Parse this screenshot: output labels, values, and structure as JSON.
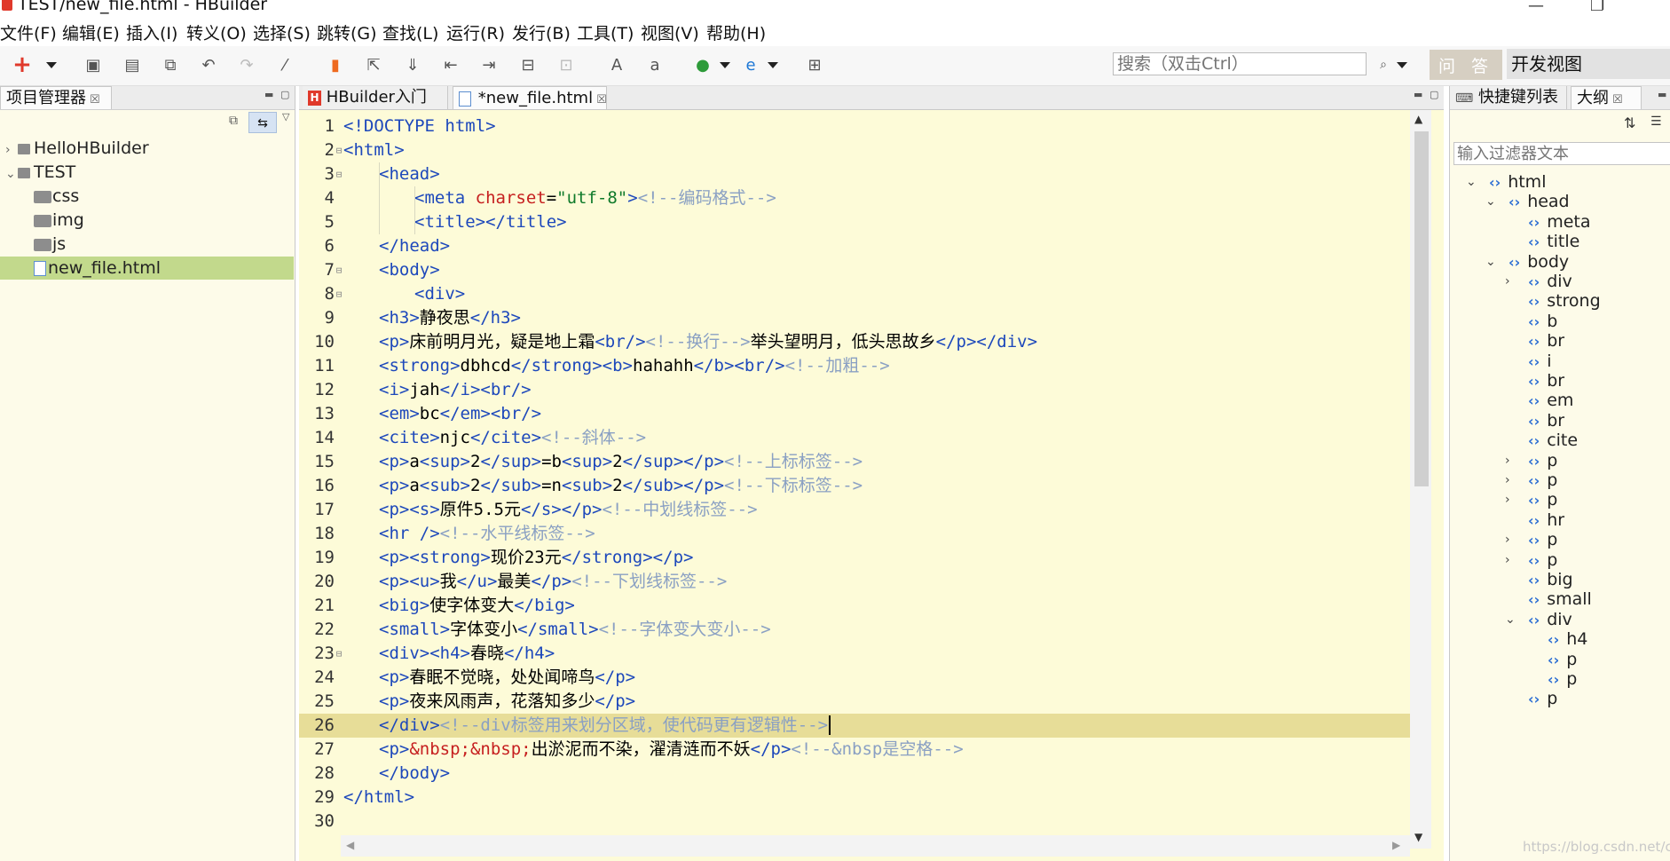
{
  "window": {
    "title": "TEST/new_file.html  -  HBuilder",
    "min_glyph": "—",
    "max_glyph": "❐"
  },
  "menu": [
    "文件(F)",
    "编辑(E)",
    "插入(I)",
    "转义(O)",
    "选择(S)",
    "跳转(G)",
    "查找(L)",
    "运行(R)",
    "发行(B)",
    "工具(T)",
    "视图(V)",
    "帮助(H)"
  ],
  "toolbar": {
    "search_placeholder": "搜索（双击Ctrl）",
    "ask_label": "问 答",
    "dev_view_label": "开发视图"
  },
  "project_panel": {
    "tab_label": "项目管理器",
    "items": [
      {
        "name": "HelloHBuilder",
        "type": "project",
        "level": 0,
        "expanded": false
      },
      {
        "name": "TEST",
        "type": "project",
        "level": 0,
        "expanded": true
      },
      {
        "name": "css",
        "type": "folder",
        "level": 1
      },
      {
        "name": "img",
        "type": "folder",
        "level": 1
      },
      {
        "name": "js",
        "type": "folder",
        "level": 1
      },
      {
        "name": "new_file.html",
        "type": "file",
        "level": 1,
        "selected": true
      }
    ]
  },
  "editor": {
    "tabs": [
      {
        "label": "HBuilder入门",
        "active": false
      },
      {
        "label": "*new_file.html",
        "active": true
      }
    ],
    "current_line": 26,
    "lines": [
      {
        "n": 1,
        "fold": false,
        "indent": 0,
        "tokens": [
          [
            "tg",
            "<!DOCTYPE html>"
          ]
        ]
      },
      {
        "n": 2,
        "fold": true,
        "indent": 0,
        "tokens": [
          [
            "tg",
            "<html>"
          ]
        ]
      },
      {
        "n": 3,
        "fold": true,
        "indent": 1,
        "tokens": [
          [
            "tg",
            "<head>"
          ]
        ]
      },
      {
        "n": 4,
        "fold": false,
        "indent": 2,
        "tokens": [
          [
            "tg",
            "<meta "
          ],
          [
            "at",
            "charset"
          ],
          [
            "tx",
            "="
          ],
          [
            "st",
            "\"utf-8\""
          ],
          [
            "tg",
            ">"
          ],
          [
            "cm",
            "<!--编码格式-->"
          ]
        ]
      },
      {
        "n": 5,
        "fold": false,
        "indent": 2,
        "tokens": [
          [
            "tg",
            "<title></title>"
          ]
        ]
      },
      {
        "n": 6,
        "fold": false,
        "indent": 1,
        "tokens": [
          [
            "tg",
            "</head>"
          ]
        ]
      },
      {
        "n": 7,
        "fold": true,
        "indent": 1,
        "tokens": [
          [
            "tg",
            "<body>"
          ]
        ]
      },
      {
        "n": 8,
        "fold": true,
        "indent": 2,
        "tokens": [
          [
            "tg",
            "<div>"
          ]
        ]
      },
      {
        "n": 9,
        "fold": false,
        "indent": 1,
        "tokens": [
          [
            "tg",
            "<h3>"
          ],
          [
            "tx",
            "静夜思"
          ],
          [
            "tg",
            "</h3>"
          ]
        ]
      },
      {
        "n": 10,
        "fold": false,
        "indent": 1,
        "tokens": [
          [
            "tg",
            "<p>"
          ],
          [
            "tx",
            "床前明月光，疑是地上霜"
          ],
          [
            "tg",
            "<br/>"
          ],
          [
            "cm",
            "<!--换行-->"
          ],
          [
            "tx",
            "举头望明月，低头思故乡"
          ],
          [
            "tg",
            "</p></div>"
          ]
        ]
      },
      {
        "n": 11,
        "fold": false,
        "indent": 1,
        "tokens": [
          [
            "tg",
            "<strong>"
          ],
          [
            "tx",
            "dbhcd"
          ],
          [
            "tg",
            "</strong><b>"
          ],
          [
            "tx",
            "hahahh"
          ],
          [
            "tg",
            "</b><br/>"
          ],
          [
            "cm",
            "<!--加粗-->"
          ]
        ]
      },
      {
        "n": 12,
        "fold": false,
        "indent": 1,
        "tokens": [
          [
            "tg",
            "<i>"
          ],
          [
            "tx",
            "jah"
          ],
          [
            "tg",
            "</i><br/>"
          ]
        ]
      },
      {
        "n": 13,
        "fold": false,
        "indent": 1,
        "tokens": [
          [
            "tg",
            "<em>"
          ],
          [
            "tx",
            "bc"
          ],
          [
            "tg",
            "</em><br/>"
          ]
        ]
      },
      {
        "n": 14,
        "fold": false,
        "indent": 1,
        "tokens": [
          [
            "tg",
            "<cite>"
          ],
          [
            "tx",
            "njc"
          ],
          [
            "tg",
            "</cite>"
          ],
          [
            "cm",
            "<!--斜体-->"
          ]
        ]
      },
      {
        "n": 15,
        "fold": false,
        "indent": 1,
        "tokens": [
          [
            "tg",
            "<p>"
          ],
          [
            "tx",
            "a"
          ],
          [
            "tg",
            "<sup>"
          ],
          [
            "tx",
            "2"
          ],
          [
            "tg",
            "</sup>"
          ],
          [
            "tx",
            "=b"
          ],
          [
            "tg",
            "<sup>"
          ],
          [
            "tx",
            "2"
          ],
          [
            "tg",
            "</sup></p>"
          ],
          [
            "cm",
            "<!--上标标签-->"
          ]
        ]
      },
      {
        "n": 16,
        "fold": false,
        "indent": 1,
        "tokens": [
          [
            "tg",
            "<p>"
          ],
          [
            "tx",
            "a"
          ],
          [
            "tg",
            "<sub>"
          ],
          [
            "tx",
            "2"
          ],
          [
            "tg",
            "</sub>"
          ],
          [
            "tx",
            "=n"
          ],
          [
            "tg",
            "<sub>"
          ],
          [
            "tx",
            "2"
          ],
          [
            "tg",
            "</sub></p>"
          ],
          [
            "cm",
            "<!--下标标签-->"
          ]
        ]
      },
      {
        "n": 17,
        "fold": false,
        "indent": 1,
        "tokens": [
          [
            "tg",
            "<p><s>"
          ],
          [
            "tx",
            "原件5.5元"
          ],
          [
            "tg",
            "</s></p>"
          ],
          [
            "cm",
            "<!--中划线标签-->"
          ]
        ]
      },
      {
        "n": 18,
        "fold": false,
        "indent": 1,
        "tokens": [
          [
            "tg",
            "<hr />"
          ],
          [
            "cm",
            "<!--水平线标签-->"
          ]
        ]
      },
      {
        "n": 19,
        "fold": false,
        "indent": 1,
        "tokens": [
          [
            "tg",
            "<p><strong>"
          ],
          [
            "tx",
            "现价23元"
          ],
          [
            "tg",
            "</strong></p>"
          ]
        ]
      },
      {
        "n": 20,
        "fold": false,
        "indent": 1,
        "tokens": [
          [
            "tg",
            "<p><u>"
          ],
          [
            "tx",
            "我"
          ],
          [
            "tg",
            "</u>"
          ],
          [
            "tx",
            "最美"
          ],
          [
            "tg",
            "</p>"
          ],
          [
            "cm",
            "<!--下划线标签-->"
          ]
        ]
      },
      {
        "n": 21,
        "fold": false,
        "indent": 1,
        "tokens": [
          [
            "tg",
            "<big>"
          ],
          [
            "tx",
            "使字体变大"
          ],
          [
            "tg",
            "</big>"
          ]
        ]
      },
      {
        "n": 22,
        "fold": false,
        "indent": 1,
        "tokens": [
          [
            "tg",
            "<small>"
          ],
          [
            "tx",
            "字体变小"
          ],
          [
            "tg",
            "</small>"
          ],
          [
            "cm",
            "<!--字体变大变小-->"
          ]
        ]
      },
      {
        "n": 23,
        "fold": true,
        "indent": 1,
        "tokens": [
          [
            "tg",
            "<div><h4>"
          ],
          [
            "tx",
            "春晓"
          ],
          [
            "tg",
            "</h4>"
          ]
        ]
      },
      {
        "n": 24,
        "fold": false,
        "indent": 1,
        "tokens": [
          [
            "tg",
            "<p>"
          ],
          [
            "tx",
            "春眠不觉晓，处处闻啼鸟"
          ],
          [
            "tg",
            "</p>"
          ]
        ]
      },
      {
        "n": 25,
        "fold": false,
        "indent": 1,
        "tokens": [
          [
            "tg",
            "<p>"
          ],
          [
            "tx",
            "夜来风雨声，花落知多少"
          ],
          [
            "tg",
            "</p>"
          ]
        ]
      },
      {
        "n": 26,
        "fold": false,
        "indent": 1,
        "tokens": [
          [
            "tg",
            "</div>"
          ],
          [
            "cm",
            "<!--div标签用来划分区域，使代码更有逻辑性-->"
          ]
        ]
      },
      {
        "n": 27,
        "fold": false,
        "indent": 1,
        "tokens": [
          [
            "tg",
            "<p>"
          ],
          [
            "en",
            "&nbsp;&nbsp;"
          ],
          [
            "tx",
            "出淤泥而不染，濯清涟而不妖"
          ],
          [
            "tg",
            "</p>"
          ],
          [
            "cm",
            "<!--&nbsp是空格-->"
          ]
        ]
      },
      {
        "n": 28,
        "fold": false,
        "indent": 1,
        "tokens": [
          [
            "tg",
            "</body>"
          ]
        ]
      },
      {
        "n": 29,
        "fold": false,
        "indent": 0,
        "tokens": [
          [
            "tg",
            "</html>"
          ]
        ]
      },
      {
        "n": 30,
        "fold": false,
        "indent": 0,
        "tokens": []
      }
    ]
  },
  "outline_panel": {
    "tabs": [
      {
        "label": "快捷键列表",
        "active": false
      },
      {
        "label": "大纲",
        "active": true
      }
    ],
    "filter_placeholder": "输入过滤器文本",
    "items": [
      {
        "label": "html",
        "level": 0,
        "chev": "down"
      },
      {
        "label": "head",
        "level": 1,
        "chev": "down"
      },
      {
        "label": "meta",
        "level": 2,
        "chev": ""
      },
      {
        "label": "title",
        "level": 2,
        "chev": ""
      },
      {
        "label": "body",
        "level": 1,
        "chev": "down"
      },
      {
        "label": "div",
        "level": 2,
        "chev": "right"
      },
      {
        "label": "strong",
        "level": 2,
        "chev": ""
      },
      {
        "label": "b",
        "level": 2,
        "chev": ""
      },
      {
        "label": "br",
        "level": 2,
        "chev": ""
      },
      {
        "label": "i",
        "level": 2,
        "chev": ""
      },
      {
        "label": "br",
        "level": 2,
        "chev": ""
      },
      {
        "label": "em",
        "level": 2,
        "chev": ""
      },
      {
        "label": "br",
        "level": 2,
        "chev": ""
      },
      {
        "label": "cite",
        "level": 2,
        "chev": ""
      },
      {
        "label": "p",
        "level": 2,
        "chev": "right"
      },
      {
        "label": "p",
        "level": 2,
        "chev": "right"
      },
      {
        "label": "p",
        "level": 2,
        "chev": "right"
      },
      {
        "label": "hr",
        "level": 2,
        "chev": ""
      },
      {
        "label": "p",
        "level": 2,
        "chev": "right"
      },
      {
        "label": "p",
        "level": 2,
        "chev": "right"
      },
      {
        "label": "big",
        "level": 2,
        "chev": ""
      },
      {
        "label": "small",
        "level": 2,
        "chev": ""
      },
      {
        "label": "div",
        "level": 2,
        "chev": "down"
      },
      {
        "label": "h4",
        "level": 3,
        "chev": ""
      },
      {
        "label": "p",
        "level": 3,
        "chev": ""
      },
      {
        "label": "p",
        "level": 3,
        "chev": ""
      },
      {
        "label": "p",
        "level": 2,
        "chev": ""
      }
    ]
  },
  "watermark": "https://blog.csdn.net/cmyhahh"
}
